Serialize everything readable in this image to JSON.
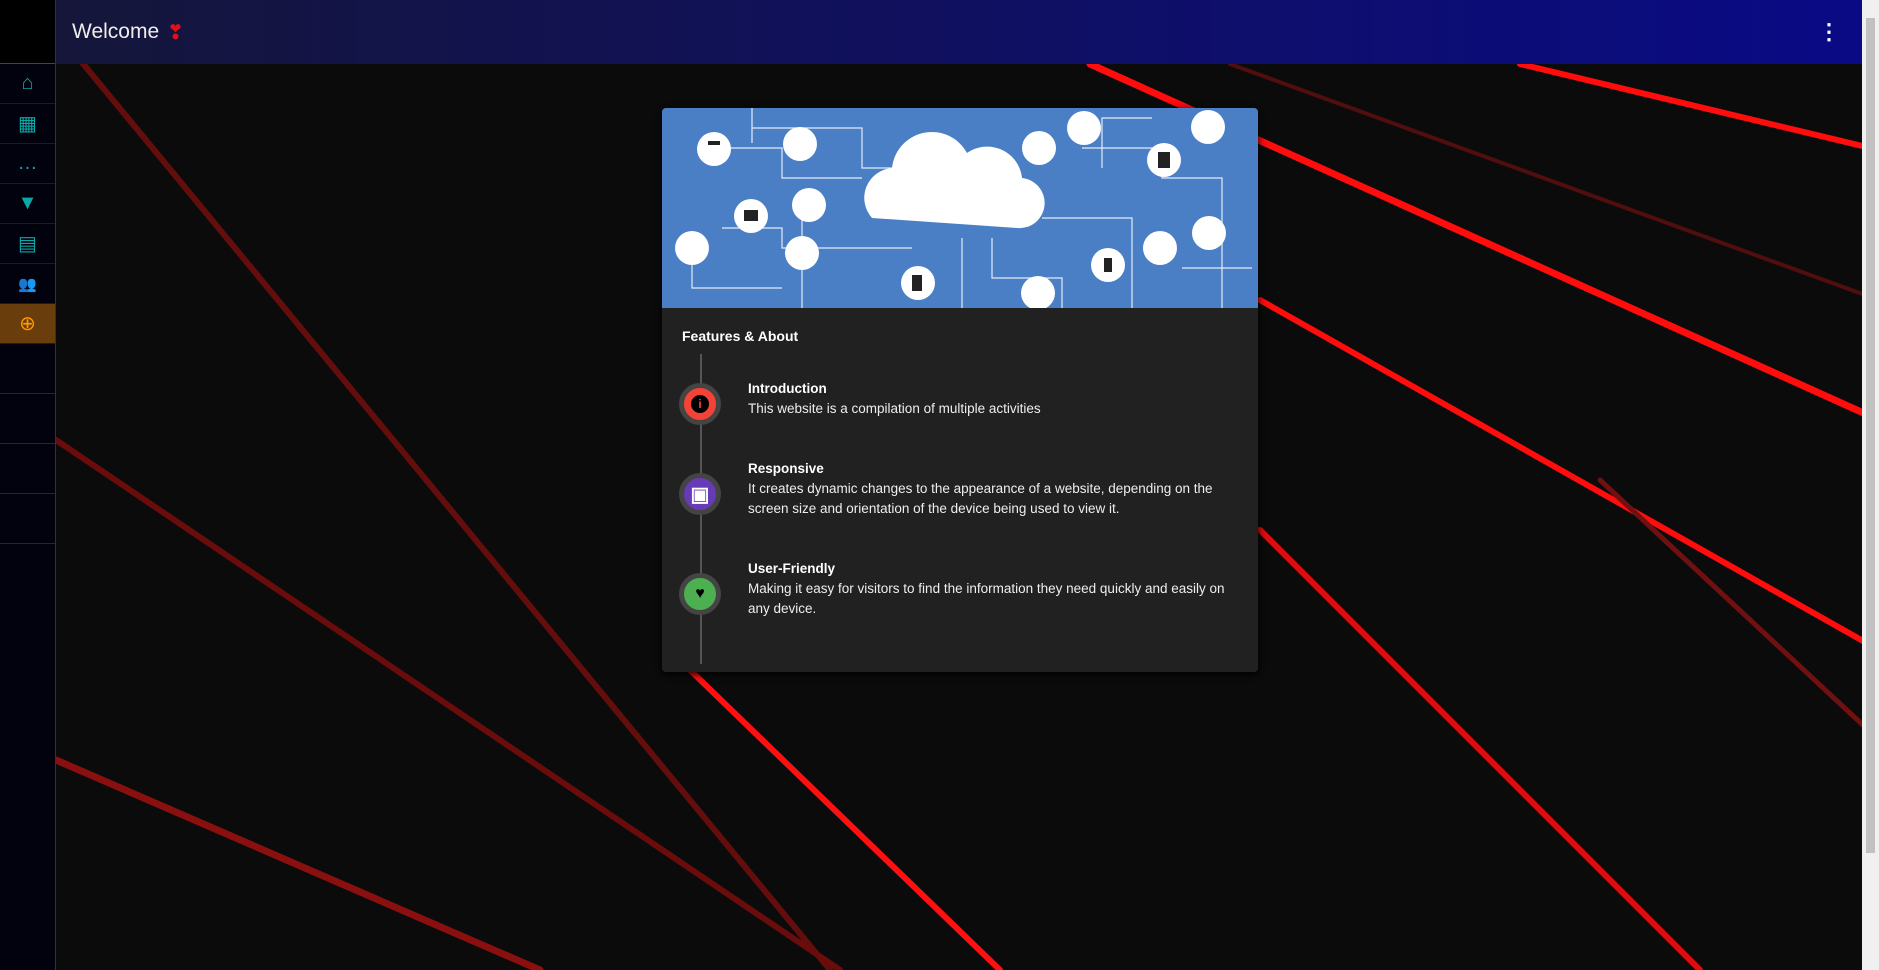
{
  "header": {
    "title": "Welcome",
    "heart_icon": "heart-icon",
    "menu_icon": "more-vert-icon"
  },
  "sidebar": {
    "items": [
      {
        "name": "home",
        "icon": "⌂"
      },
      {
        "name": "calculator",
        "icon": "▦"
      },
      {
        "name": "chat",
        "icon": "…"
      },
      {
        "name": "vue",
        "icon": "▼"
      },
      {
        "name": "reader",
        "icon": "▤"
      },
      {
        "name": "users",
        "icon": "👥"
      },
      {
        "name": "globe",
        "icon": "⊕"
      }
    ]
  },
  "card": {
    "title": "Features & About",
    "items": [
      {
        "title": "Introduction",
        "text": "This website is a compilation of multiple activities",
        "color": "#f44336",
        "icon": "i"
      },
      {
        "title": "Responsive",
        "text": "It creates dynamic changes to the appearance of a website, depending on the screen size and orientation of the device being used to view it.",
        "color": "#673ab7",
        "icon": "▣"
      },
      {
        "title": "User-Friendly",
        "text": "Making it easy for visitors to find the information they need quickly and easily on any device.",
        "color": "#4caf50",
        "icon": "♥"
      }
    ]
  }
}
